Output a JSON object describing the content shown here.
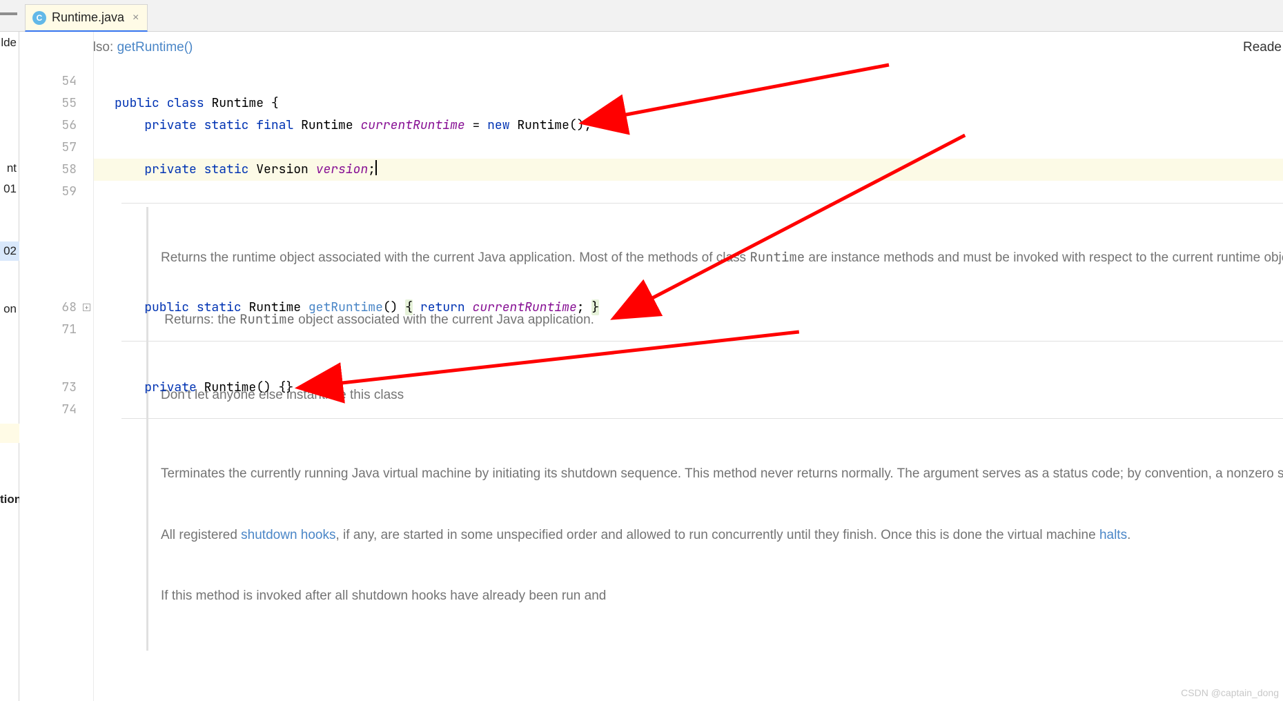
{
  "tab": {
    "icon_letter": "C",
    "filename": "Runtime.java",
    "close_glyph": "×"
  },
  "see_also": {
    "label": "See Also:",
    "link": "getRuntime()"
  },
  "reade_label": "Reade",
  "left_sliver": {
    "lde": "lde",
    "nt": "nt",
    "o1": "01",
    "o2": "02",
    "on": "on",
    "tion": "tion"
  },
  "line_numbers": [
    "54",
    "55",
    "56",
    "57",
    "58",
    "59",
    "68",
    "71",
    "73",
    "74"
  ],
  "code": {
    "l55": {
      "kw1": "public",
      "kw2": "class",
      "name": "Runtime",
      "brace": "{"
    },
    "l56": {
      "kw1": "private",
      "kw2": "static",
      "kw3": "final",
      "type": "Runtime",
      "field": "currentRuntime",
      "eq": " = ",
      "kw_new": "new",
      "ctor": "Runtime",
      "tail": "();"
    },
    "l58": {
      "kw1": "private",
      "kw2": "static",
      "type": "Version",
      "field": "version",
      "tail": ";"
    },
    "l68": {
      "kw1": "public",
      "kw2": "static",
      "type": "Runtime",
      "method": "getRuntime",
      "paren": "()",
      "brace_open": "{",
      "kw_return": "return",
      "field": "currentRuntime",
      "semi": ";",
      "brace_close": "}"
    },
    "l73": {
      "kw1": "private",
      "ctor": "Runtime",
      "tail": "() {}"
    }
  },
  "doc1": {
    "p1a": "Returns the runtime object associated with the current Java application. Most of the methods of class ",
    "p1code": "Runtime",
    "p1b": " are instance methods and must be invoked with respect to the current runtime object.",
    "p2a": " Returns: the ",
    "p2code": "Runtime",
    "p2b": " object associated with the current Java application."
  },
  "doc2": {
    "p1": "Don't let anyone else instantiate this class"
  },
  "doc3": {
    "p1": "Terminates the currently running Java virtual machine by initiating its shutdown sequence. This method never returns normally. The argument serves as a status code; by convention, a nonzero status code indicates abnormal termination.",
    "p2a": "All registered ",
    "p2link1": "shutdown hooks",
    "p2b": ", if any, are started in some unspecified order and allowed to run concurrently until they finish. Once this is done the virtual machine ",
    "p2link2": "halts",
    "p2c": ".",
    "p3": "If this method is invoked after all shutdown hooks have already been run and"
  },
  "watermark": "CSDN @captain_dong"
}
